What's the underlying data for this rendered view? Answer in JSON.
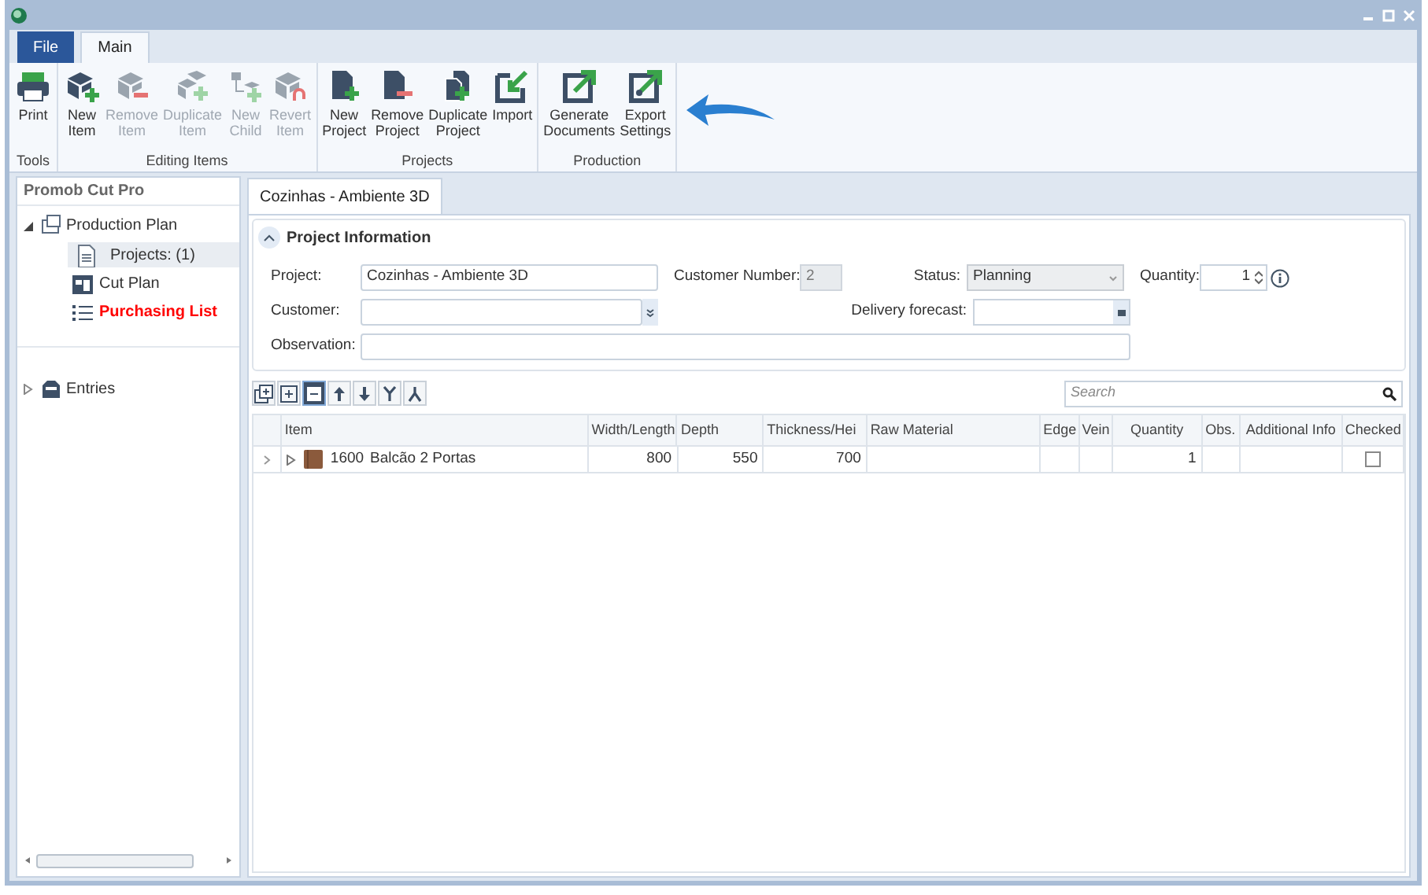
{
  "menu_tabs": [
    {
      "label": "File",
      "kind": "file",
      "selected": false
    },
    {
      "label": "Main",
      "kind": "tab",
      "selected": true
    }
  ],
  "ribbon_groups": [
    {
      "label": "Tools",
      "buttons": [
        {
          "label": "Print",
          "kind": "print",
          "disabled": false
        }
      ]
    },
    {
      "label": "Editing Items",
      "buttons": [
        {
          "label": "New Item",
          "kind": "box-add",
          "disabled": false
        },
        {
          "label": "Remove Item",
          "kind": "box-remove",
          "disabled": true
        },
        {
          "label": "Duplicate Item",
          "kind": "box-copy",
          "disabled": true
        },
        {
          "label": "New Child",
          "kind": "child-add",
          "disabled": true
        },
        {
          "label": "Revert Item",
          "kind": "box-revert",
          "disabled": true
        }
      ]
    },
    {
      "label": "Projects",
      "buttons": [
        {
          "label": "New Project",
          "kind": "doc-add",
          "disabled": false
        },
        {
          "label": "Remove Project",
          "kind": "doc-remove",
          "disabled": false
        },
        {
          "label": "Duplicate Project",
          "kind": "doc-copy",
          "disabled": false
        },
        {
          "label": "Import",
          "kind": "import",
          "disabled": false
        }
      ]
    },
    {
      "label": "Production",
      "buttons": [
        {
          "label": "Generate Documents",
          "kind": "export",
          "disabled": false
        },
        {
          "label": "Export Settings",
          "kind": "export-gear",
          "disabled": false
        }
      ]
    }
  ],
  "sidebar": {
    "title": "Promob Cut Pro",
    "tree": [
      {
        "label": "Production Plan",
        "kind": "plan",
        "expanded": true,
        "children": [
          {
            "label": "Projects: (1)",
            "kind": "doc",
            "selected": true,
            "highlighted": false
          },
          {
            "label": "Cut Plan",
            "kind": "cut",
            "selected": false,
            "highlighted": false
          },
          {
            "label": "Purchasing List",
            "kind": "list",
            "selected": false,
            "highlighted": true
          }
        ]
      },
      {
        "label": "Entries",
        "kind": "entries",
        "expanded": false
      }
    ]
  },
  "document_tab": {
    "label": "Cozinhas - Ambiente 3D"
  },
  "project_info": {
    "title": "Project Information",
    "expanded": true,
    "project": {
      "label": "Project:",
      "value": "Cozinhas - Ambiente 3D"
    },
    "customer_number": {
      "label": "Customer Number:",
      "value": "2"
    },
    "status": {
      "label": "Status:",
      "value": "Planning"
    },
    "quantity": {
      "label": "Quantity:",
      "value": "1"
    },
    "customer": {
      "label": "Customer:"
    },
    "delivery_forecast": {
      "label": "Delivery forecast:"
    },
    "observation": {
      "label": "Observation:"
    }
  },
  "grid_toolbar": [
    {
      "kind": "expand-all",
      "selected": false
    },
    {
      "kind": "add",
      "selected": false
    },
    {
      "kind": "collapse",
      "selected": true
    },
    {
      "kind": "up",
      "selected": false
    },
    {
      "kind": "down",
      "selected": false
    },
    {
      "kind": "merge",
      "selected": false
    },
    {
      "kind": "split",
      "selected": false
    }
  ],
  "search": {
    "placeholder": "Search"
  },
  "table": {
    "columns": [
      "Item",
      "Width/Length",
      "Depth",
      "Thickness/Hei",
      "Raw Material",
      "Edge",
      "Vein",
      "Quantity",
      "Obs.",
      "Additional Info",
      "Checked"
    ],
    "rows": [
      {
        "expanded": false,
        "code": "1600",
        "name": "Balcão 2 Portas",
        "width_length": "800",
        "depth": "550",
        "thickness": "700",
        "quantity": "1",
        "checked": false
      }
    ]
  }
}
